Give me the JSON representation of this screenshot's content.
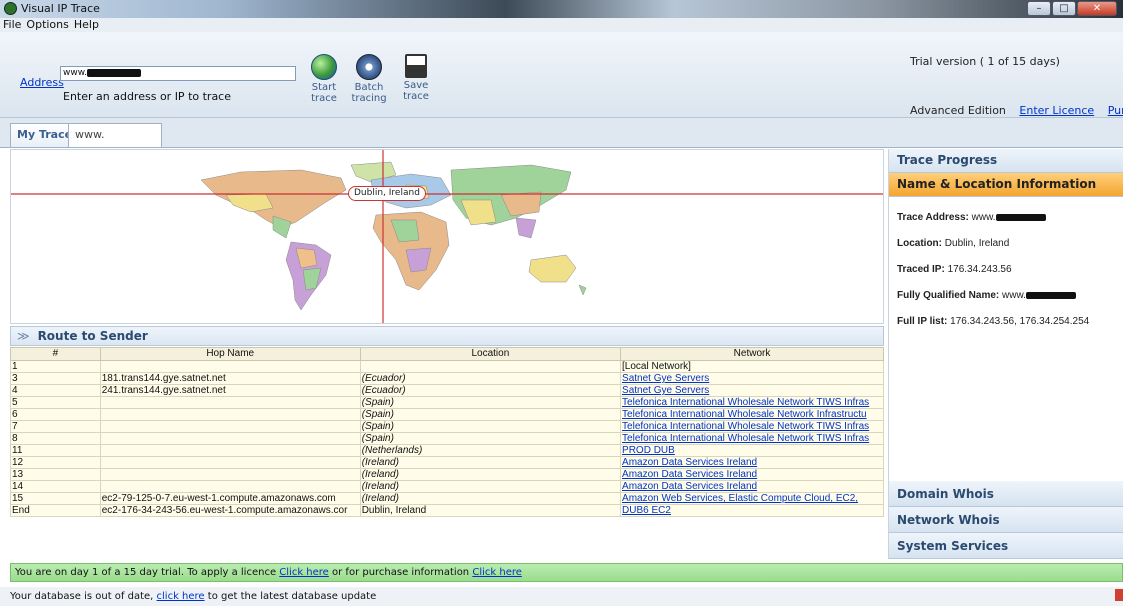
{
  "window": {
    "title": "Visual IP Trace"
  },
  "menu": [
    "File",
    "Options",
    "Help"
  ],
  "toolbar": {
    "address_label": "Address",
    "address_value": "www.",
    "hint": "Enter an address or IP to trace",
    "buttons": [
      {
        "label1": "Start",
        "label2": "trace",
        "icon": "globe-icon"
      },
      {
        "label1": "Batch",
        "label2": "tracing",
        "icon": "batch-icon"
      },
      {
        "label1": "Save",
        "label2": "trace",
        "icon": "floppy-disk-icon"
      }
    ],
    "trial_text": "Trial version ( 1 of 15 days)",
    "edition": "Advanced Edition",
    "enter_licence": "Enter Licence",
    "purchase": "Purchase"
  },
  "tabs": [
    {
      "label": "My Traces"
    },
    {
      "label": "www."
    }
  ],
  "map": {
    "label": "Dublin, Ireland"
  },
  "route": {
    "title": "Route to Sender",
    "columns": [
      "#",
      "Hop Name",
      "Location",
      "Network"
    ],
    "rows": [
      {
        "n": "1",
        "hop": "",
        "loc": "",
        "net": "[Local Network]",
        "link": false
      },
      {
        "n": "3",
        "hop": "181.trans144.gye.satnet.net",
        "loc": "(Ecuador)",
        "net": "Satnet Gye Servers",
        "link": true
      },
      {
        "n": "4",
        "hop": "241.trans144.gye.satnet.net",
        "loc": "(Ecuador)",
        "net": "Satnet Gye Servers",
        "link": true
      },
      {
        "n": "5",
        "hop": "",
        "loc": "(Spain)",
        "net": "Telefonica International Wholesale Network TIWS Infras",
        "link": true
      },
      {
        "n": "6",
        "hop": "",
        "loc": "(Spain)",
        "net": "Telefonica International Wholesale Network Infrastructu",
        "link": true
      },
      {
        "n": "7",
        "hop": "",
        "loc": "(Spain)",
        "net": "Telefonica International Wholesale Network TIWS Infras",
        "link": true
      },
      {
        "n": "8",
        "hop": "",
        "loc": "(Spain)",
        "net": "Telefonica International Wholesale Network TIWS Infras",
        "link": true
      },
      {
        "n": "11",
        "hop": "",
        "loc": "(Netherlands)",
        "net": "PROD DUB",
        "link": true
      },
      {
        "n": "12",
        "hop": "",
        "loc": "(Ireland)",
        "net": "Amazon Data Services Ireland",
        "link": true
      },
      {
        "n": "13",
        "hop": "",
        "loc": "(Ireland)",
        "net": "Amazon Data Services Ireland",
        "link": true
      },
      {
        "n": "14",
        "hop": "",
        "loc": "(Ireland)",
        "net": "Amazon Data Services Ireland",
        "link": true
      },
      {
        "n": "15",
        "hop": "ec2-79-125-0-7.eu-west-1.compute.amazonaws.com",
        "loc": "(Ireland)",
        "net": "Amazon Web Services, Elastic Compute Cloud, EC2,",
        "link": true
      },
      {
        "n": "End",
        "hop": "ec2-176-34-243-56.eu-west-1.compute.amazonaws.cor",
        "loc": "Dublin, Ireland",
        "net": "DUB6 EC2",
        "link": true,
        "plainloc": true
      }
    ]
  },
  "panel": {
    "trace_progress": "Trace Progress",
    "name_location": "Name & Location Information",
    "trace_address_label": "Trace Address:",
    "trace_address_value": "www.",
    "location_label": "Location:",
    "location_value": "Dublin, Ireland",
    "traced_ip_label": "Traced IP:",
    "traced_ip_value": "176.34.243.56",
    "fqdn_label": "Fully Qualified Name:",
    "fqdn_value": "www.",
    "full_ip_label": "Full IP list:",
    "full_ip_value": "176.34.243.56, 176.34.254.254",
    "domain_whois": "Domain Whois",
    "network_whois": "Network Whois",
    "system_services": "System Services"
  },
  "status": {
    "trial_prefix": "You are on day 1 of a 15 day trial. To apply a licence",
    "click_here": "Click here",
    "trial_middle": "or for purchase information",
    "db_prefix": "Your database is out of date,",
    "db_link": "click here",
    "db_suffix": "to get the latest database update"
  }
}
